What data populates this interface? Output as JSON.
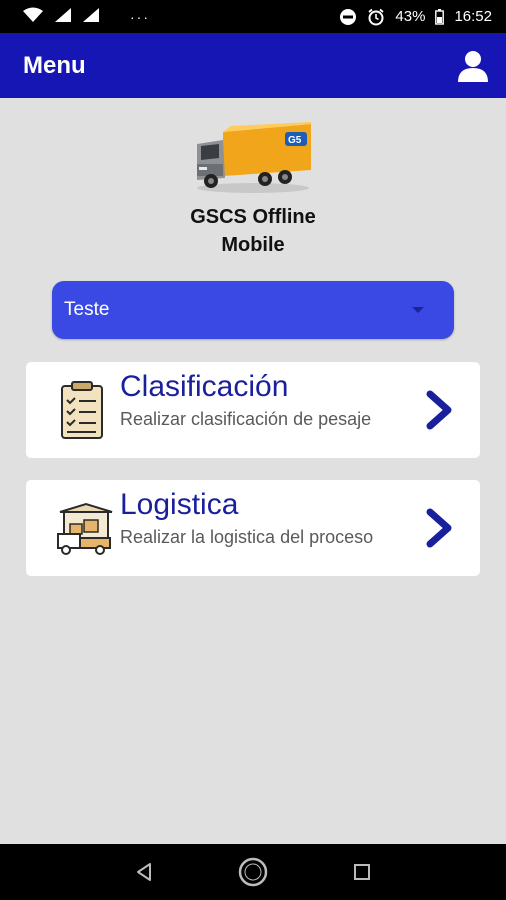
{
  "status_bar": {
    "battery": "43%",
    "time": "16:52",
    "overflow": "···"
  },
  "header": {
    "title": "Menu"
  },
  "app": {
    "name_line1": "GSCS Offline",
    "name_line2": "Mobile"
  },
  "selector": {
    "value": "Teste"
  },
  "menu": {
    "items": [
      {
        "title": "Clasificación",
        "description": "Realizar clasificación de pesaje",
        "icon": "clipboard-checklist-icon"
      },
      {
        "title": "Logistica",
        "description": "Realizar la logistica del proceso",
        "icon": "logistics-truck-icon"
      }
    ]
  },
  "colors": {
    "appbar": "#1616b4",
    "dropdown": "#3a49e3",
    "title_text": "#1a1f9c",
    "background": "#e0e0e0"
  }
}
